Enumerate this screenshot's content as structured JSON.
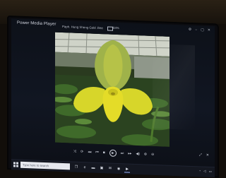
{
  "window": {
    "app_title": "Power Media Player",
    "file_name": "Paph. Hung Sheng Gold .Bee",
    "zoom": "84%"
  },
  "photo": {
    "subject": "yellow-green slipper orchid in greenhouse",
    "colors": {
      "petals": "#d7d62a",
      "dorsal_sepal": "#9fb24a",
      "pouch": "#e4dc28",
      "foliage": "#2f4a22",
      "greenhouse_roof": "#cfd3c8"
    }
  },
  "controls": {
    "icons": [
      "shuffle-icon",
      "repeat-icon",
      "rewind-icon",
      "previous-icon",
      "stop-icon",
      "play-icon",
      "next-icon",
      "fast-forward-icon",
      "volume-icon",
      "zoom-in-icon",
      "zoom-out-icon"
    ],
    "right_icons": [
      "fullscreen-icon",
      "close-icon"
    ]
  },
  "taskbar": {
    "search_placeholder": "Type here to search",
    "app_icons": [
      "task-view-icon",
      "edge-icon",
      "file-explorer-icon",
      "store-icon",
      "mail-icon",
      "chrome-icon",
      "media-player-icon"
    ]
  }
}
